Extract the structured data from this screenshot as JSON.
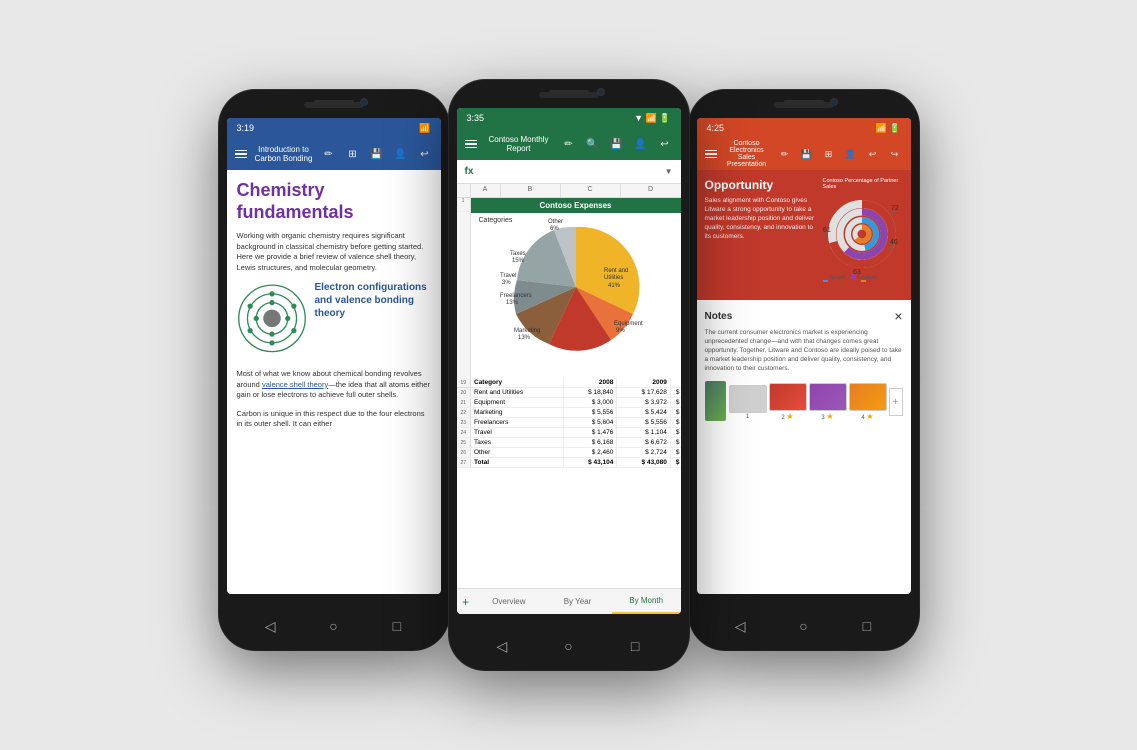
{
  "phones": {
    "left": {
      "time": "3:19",
      "app": "Word",
      "title": "Introduction to Carbon Bonding",
      "toolbar_icons": [
        "≡",
        "✏",
        "⊞",
        "💾",
        "👤",
        "↩"
      ],
      "h1": "Chemistry fundamentals",
      "body1": "Working with organic chemistry requires significant background in classical chemistry before getting started. Here we provide a brief review of valence shell theory, Lewis structures, and molecular geometry.",
      "h2": "Electron configurations and valence bonding theory",
      "body2": "Most of what we know about chemical bonding revolves around ",
      "link_text": "valence shell theory",
      "body3": "—the idea that all atoms either gain or lose electrons to achieve full outer shells.",
      "body4": "Carbon is unique in this respect due to the four electrons in its outer shell. It can either"
    },
    "center": {
      "time": "3:35",
      "app": "Excel",
      "title": "Contoso Monthly Report",
      "toolbar_icons": [
        "≡",
        "✏",
        "🔍",
        "💾",
        "👤",
        "↩"
      ],
      "formula_label": "fx",
      "chart_title": "Contoso Expenses",
      "chart_categories": "Categories",
      "pie_segments": [
        {
          "label": "Rent and Utilities",
          "pct": 41,
          "color": "#f0b429"
        },
        {
          "label": "Equipment",
          "pct": 9,
          "color": "#e8723a"
        },
        {
          "label": "Marketing",
          "pct": 13,
          "color": "#c0392b"
        },
        {
          "label": "Freelancers",
          "pct": 13,
          "color": "#8b5e3c"
        },
        {
          "label": "Travel",
          "pct": 3,
          "color": "#7f8c8d"
        },
        {
          "label": "Taxes",
          "pct": 15,
          "color": "#95a5a6"
        },
        {
          "label": "Other",
          "pct": 6,
          "color": "#bdc3c7"
        }
      ],
      "table_headers": [
        "Category",
        "2008",
        "2009"
      ],
      "table_rows": [
        [
          "Rent and Utilities",
          "$ 18,840",
          "$ 17,628",
          "$"
        ],
        [
          "Equipment",
          "$ 3,000",
          "$ 3,972",
          "$"
        ],
        [
          "Marketing",
          "$ 5,556",
          "$ 5,424",
          "$"
        ],
        [
          "Freelancers",
          "$ 5,604",
          "$ 5,556",
          "$"
        ],
        [
          "Travel",
          "$ 1,476",
          "$ 1,104",
          "$"
        ],
        [
          "Taxes",
          "$ 6,168",
          "$ 6,672",
          "$"
        ],
        [
          "Other",
          "$ 2,460",
          "$ 2,724",
          "$"
        ],
        [
          "Total",
          "$ 43,104",
          "$ 43,080",
          "$"
        ]
      ],
      "tabs": [
        "Overview",
        "By Year",
        "By Month"
      ],
      "active_tab": "By Month"
    },
    "right": {
      "time": "4:25",
      "app": "PowerPoint",
      "title": "Contoso Electronics Sales Presentation",
      "toolbar_icons": [
        "≡",
        "✏",
        "💾",
        "⊞",
        "👤",
        "↩",
        "→"
      ],
      "slide_title": "Opportunity",
      "slide_text": "Sales alignment with Contoso gives Litware a strong opportunity to take a market leadership position and deliver quality, consistency, and innovation to its customers.",
      "chart_title": "Contoso Percentage of Partner Sales",
      "chart_values": [
        72,
        61,
        46,
        63
      ],
      "chart_colors": [
        "#c0392b",
        "#8e44ad",
        "#3498db",
        "#e67e22"
      ],
      "legend": [
        "Tailspin",
        "Fabrikam",
        "Northwind",
        "Rosemere"
      ],
      "notes_title": "Notes",
      "notes_text": "The current consumer electronics market is experiencing unprecedented change—and with that changes comes great opportunity. Together, Litware and Contoso are ideally poised to take a market leadership position and deliver quality, consistency, and innovation to their customers.",
      "thumbnails": [
        {
          "num": "1",
          "star": false
        },
        {
          "num": "2",
          "star": true
        },
        {
          "num": "3",
          "star": true
        },
        {
          "num": "4",
          "star": true
        }
      ]
    }
  },
  "nav_buttons": {
    "back": "◁",
    "home": "○",
    "menu": "□"
  }
}
